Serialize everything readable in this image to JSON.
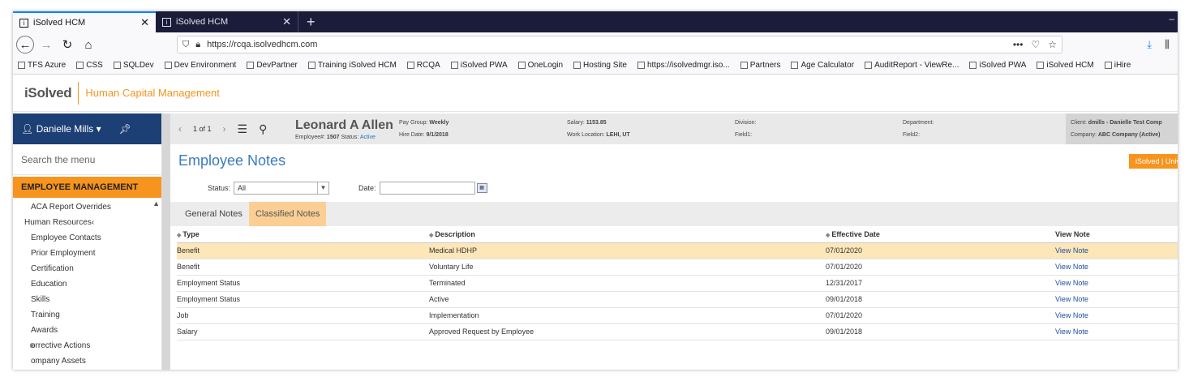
{
  "browser": {
    "tabs": [
      {
        "favicon": "i",
        "title": "iSolved HCM",
        "active": true
      },
      {
        "favicon": "i",
        "title": "iSolved HCM",
        "active": false
      }
    ],
    "url": "https://rcqa.isolvedhcm.com",
    "page_actions": "•••",
    "bookmarks": [
      "TFS Azure",
      "CSS",
      "SQLDev",
      "Dev Environment",
      "DevPartner",
      "Training iSolved HCM",
      "RCQA",
      "iSolved PWA",
      "OneLogin",
      "Hosting Site",
      "https://isolvedmgr.iso...",
      "Partners",
      "Age Calculator",
      "AuditReport - ViewRe...",
      "iSolved PWA",
      "iSolved HCM",
      "iHire"
    ]
  },
  "app": {
    "logo_text": "iSolved",
    "title": "Human Capital Management",
    "accent_color": "#f7941d",
    "nav_color": "#1c3f75"
  },
  "sidebar": {
    "user": "Danielle Mills",
    "search_placeholder": "Search the menu",
    "section": "EMPLOYEE MANAGEMENT",
    "items": [
      {
        "label": "ACA Report Overrides",
        "kind": "item"
      },
      {
        "label": "Human Resources",
        "kind": "group"
      },
      {
        "label": "Employee Contacts",
        "kind": "sub"
      },
      {
        "label": "Prior Employment",
        "kind": "sub"
      },
      {
        "label": "Certification",
        "kind": "sub"
      },
      {
        "label": "Education",
        "kind": "sub"
      },
      {
        "label": "Skills",
        "kind": "sub"
      },
      {
        "label": "Training",
        "kind": "sub"
      },
      {
        "label": "Awards",
        "kind": "sub"
      },
      {
        "label": "orrective Actions",
        "kind": "sub"
      },
      {
        "label": "ompany Assets",
        "kind": "sub"
      }
    ]
  },
  "employee": {
    "pager": "1 of 1",
    "name": "Leonard A Allen",
    "employee_label": "Employee#:",
    "employee_no": "1507",
    "status_label": "Status:",
    "status": "Active",
    "pay_group_label": "Pay Group:",
    "pay_group": "Weekly",
    "hire_date_label": "Hire Date:",
    "hire_date": "9/1/2018",
    "salary_label": "Salary:",
    "salary": "1153.85",
    "work_location_label": "Work Location:",
    "work_location": "LEHI, UT",
    "division_label": "Division:",
    "field1_label": "Field1:",
    "department_label": "Department:",
    "field2_label": "Field2:",
    "client_label": "Client:",
    "client": "dmills - Danielle Test Comp",
    "company_label": "Company:",
    "company": "ABC Company (Active)"
  },
  "page": {
    "title": "Employee Notes",
    "brand_button": "iSolved | Unive",
    "status_label": "Status:",
    "status_value": "All",
    "date_label": "Date:",
    "date_value": "",
    "tabs": [
      {
        "label": "General Notes",
        "selected": false
      },
      {
        "label": "Classified Notes",
        "selected": true
      }
    ]
  },
  "table": {
    "headers": [
      "Type",
      "Description",
      "Effective Date",
      "View Note"
    ],
    "rows": [
      {
        "type": "Benefit",
        "description": "Medical HDHP",
        "date": "07/01/2020",
        "link": "View Note",
        "highlight": true
      },
      {
        "type": "Benefit",
        "description": "Voluntary Life",
        "date": "07/01/2020",
        "link": "View Note",
        "highlight": false
      },
      {
        "type": "Employment Status",
        "description": "Terminated",
        "date": "12/31/2017",
        "link": "View Note",
        "highlight": false
      },
      {
        "type": "Employment Status",
        "description": "Active",
        "date": "09/01/2018",
        "link": "View Note",
        "highlight": false
      },
      {
        "type": "Job",
        "description": "Implementation",
        "date": "07/01/2020",
        "link": "View Note",
        "highlight": false
      },
      {
        "type": "Salary",
        "description": "Approved Request by Employee",
        "date": "09/01/2018",
        "link": "View Note",
        "highlight": false
      }
    ]
  }
}
